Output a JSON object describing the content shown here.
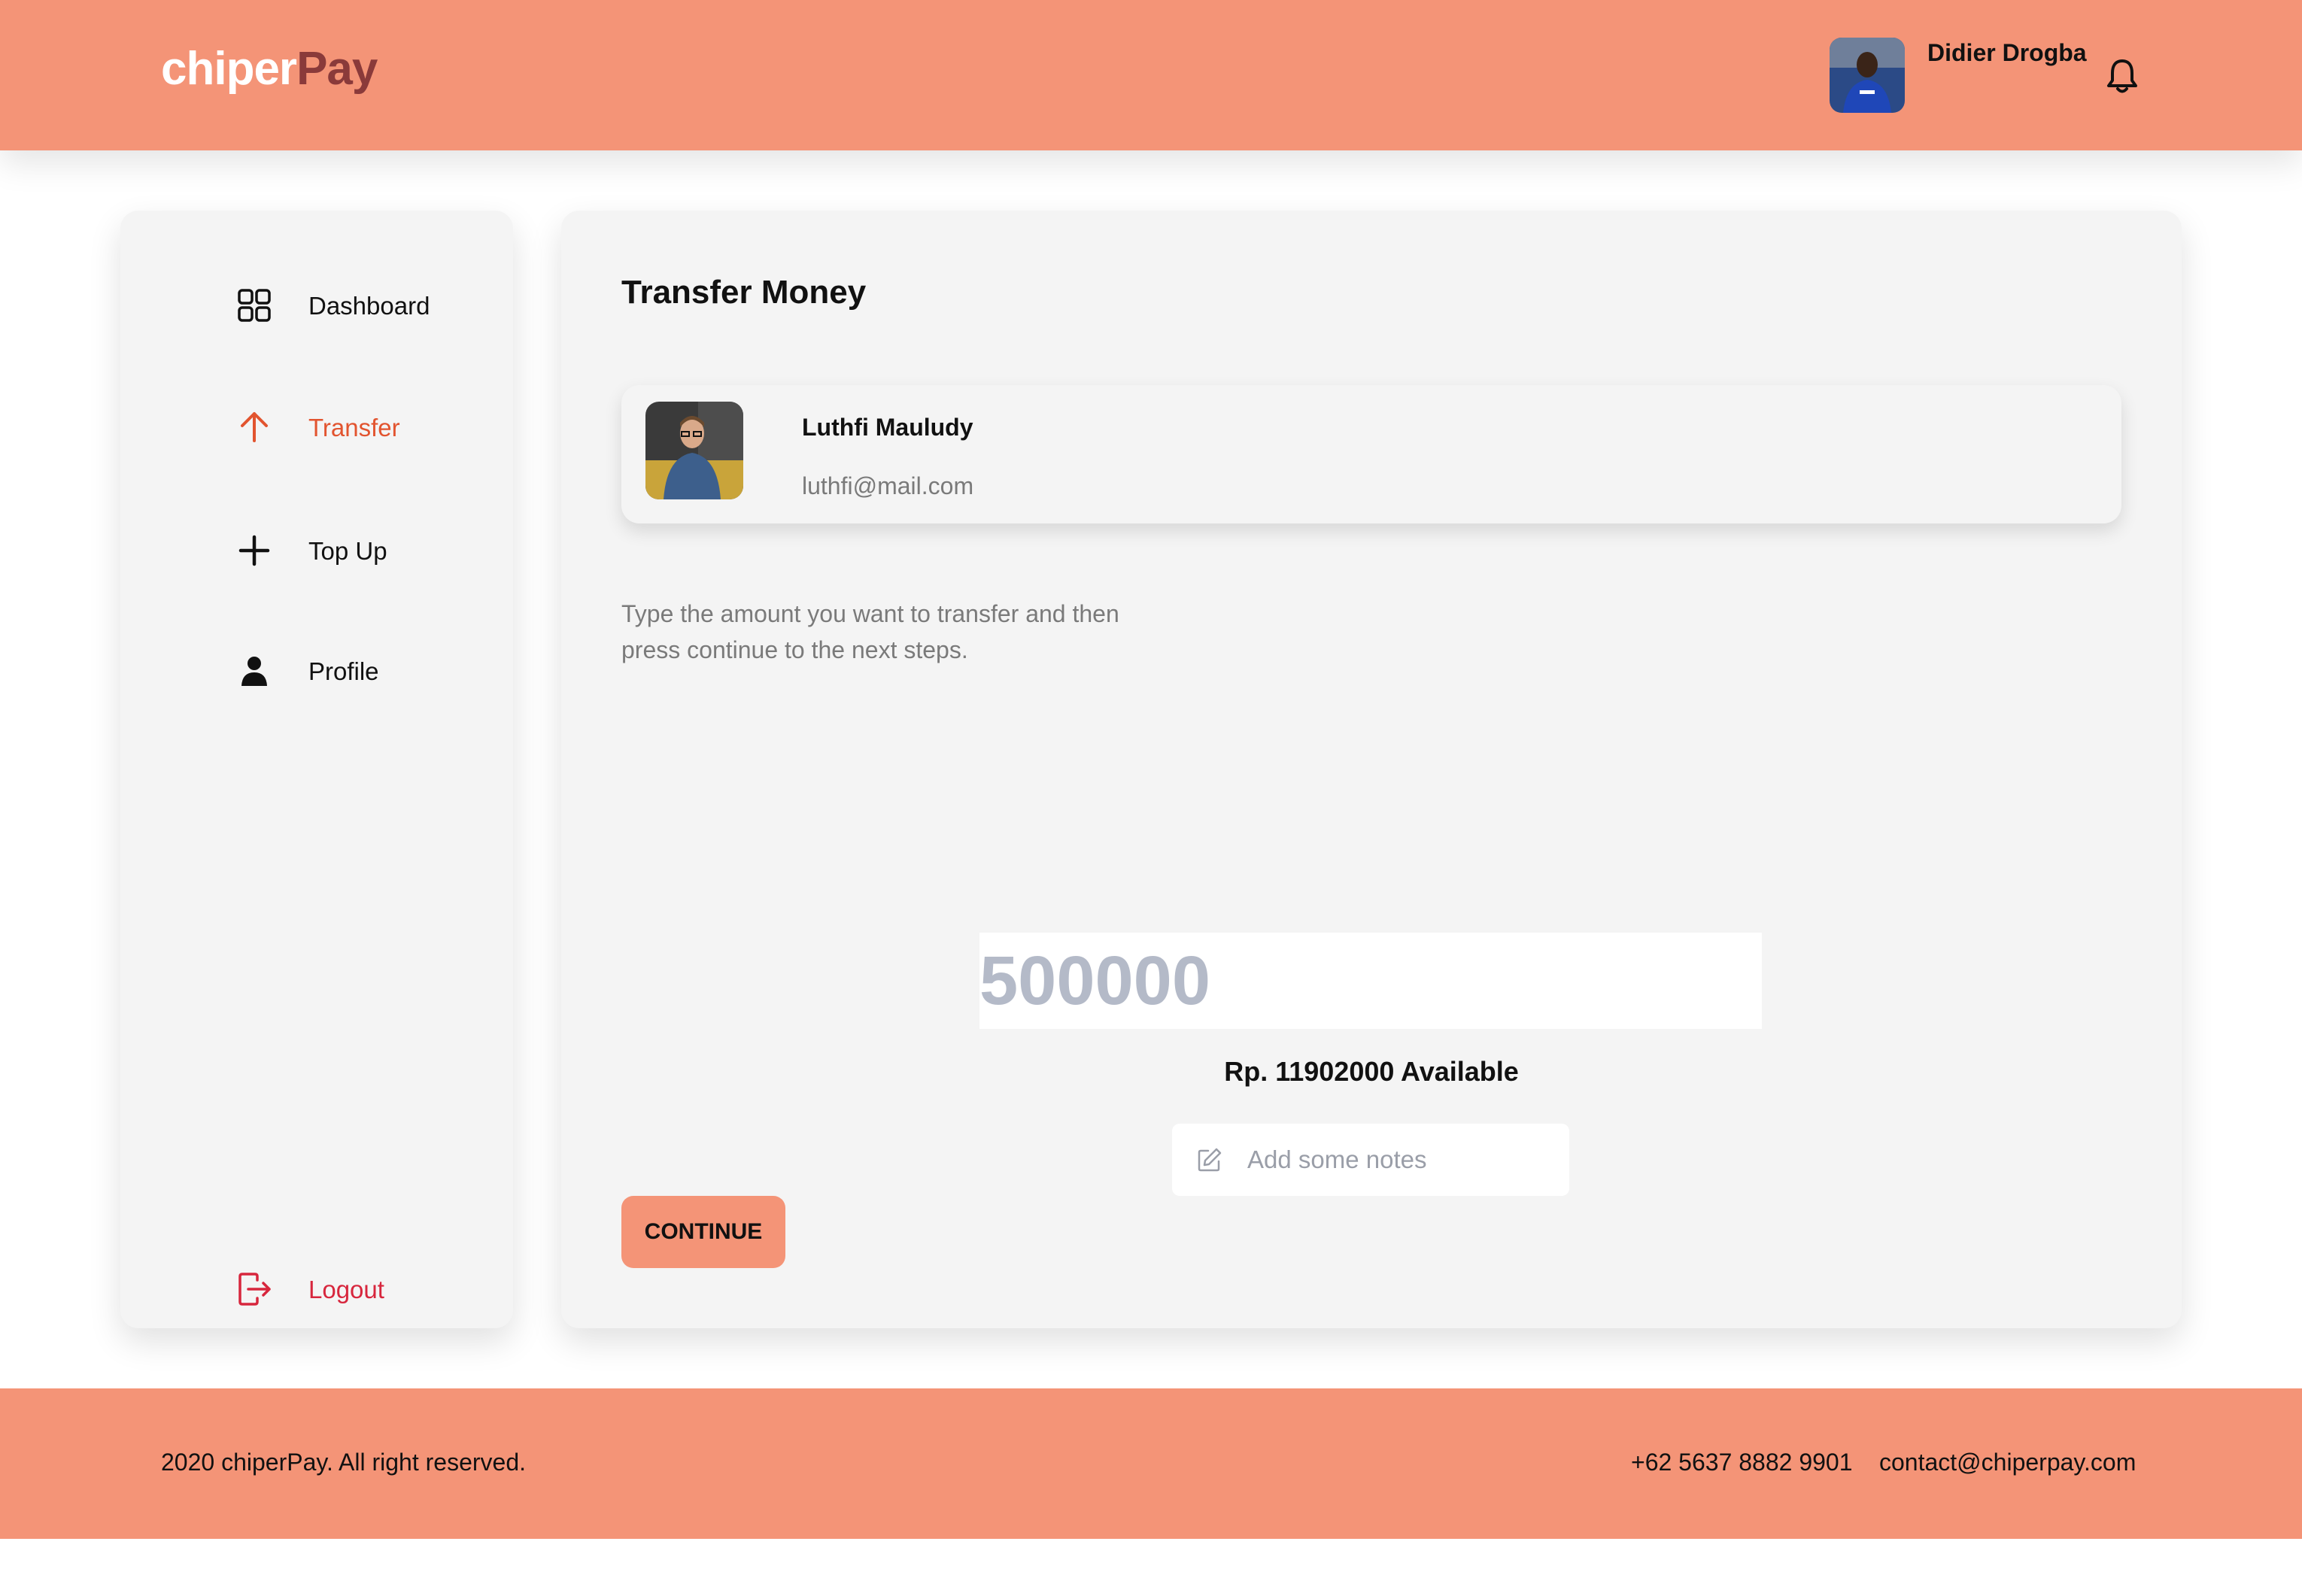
{
  "header": {
    "logo_part1": "chiper",
    "logo_part2": "Pay",
    "user_name": "Didier Drogba",
    "notification_icon": "bell-icon"
  },
  "sidebar": {
    "items": [
      {
        "label": "Dashboard",
        "icon": "grid-icon",
        "active": false
      },
      {
        "label": "Transfer",
        "icon": "arrow-up-icon",
        "active": true
      },
      {
        "label": "Top Up",
        "icon": "plus-icon",
        "active": false
      },
      {
        "label": "Profile",
        "icon": "user-icon",
        "active": false
      }
    ],
    "logout": {
      "label": "Logout",
      "icon": "logout-icon"
    }
  },
  "main": {
    "title": "Transfer Money",
    "recipient": {
      "name": "Luthfi Mauludy",
      "email": "luthfi@mail.com"
    },
    "instructions": "Type the amount you want to transfer and then press continue to the next steps.",
    "amount_placeholder": "500000",
    "balance_text": "Rp. 11902000 Available",
    "notes_placeholder": "Add some notes",
    "continue_label": "CONTINUE"
  },
  "footer": {
    "copyright": "2020 chiperPay. All right reserved.",
    "phone": "+62 5637 8882 9901",
    "email": "contact@chiperpay.com"
  },
  "colors": {
    "brand": "#f49477",
    "accent_active": "#e2542f",
    "logout": "#d7263d",
    "card_bg": "#f4f4f4"
  }
}
